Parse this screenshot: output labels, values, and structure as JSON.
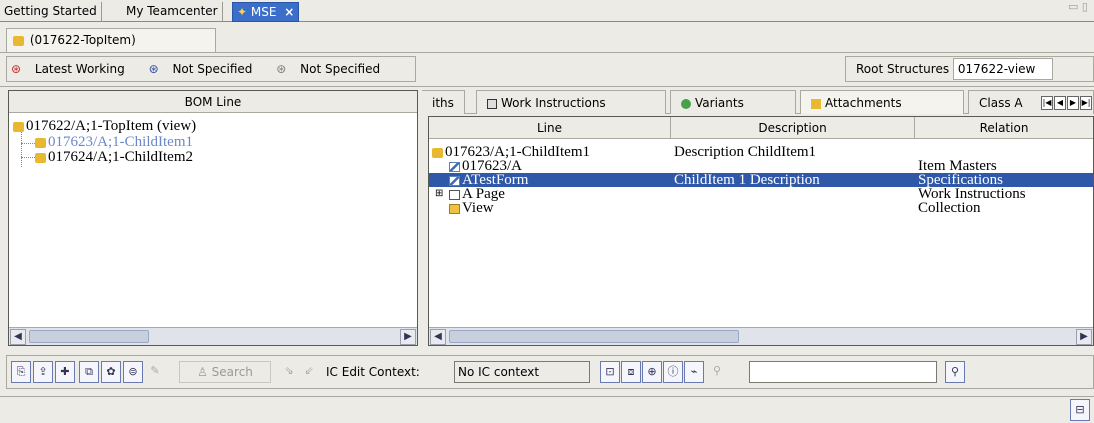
{
  "top_tabs": {
    "getting_started": "Getting Started",
    "my_teamcenter": "My Teamcenter",
    "mse": "MSE",
    "close": "×"
  },
  "sub_tab": {
    "label": "(017622-TopItem)"
  },
  "rule_bar": {
    "latest_working": "Latest Working",
    "not_specified_1": "Not Specified",
    "not_specified_2": "Not Specified",
    "root_structures_label": "Root Structures",
    "root_structures_value": "017622-view"
  },
  "bom_panel": {
    "header": "BOM Line",
    "rows": [
      {
        "label": "017622/A;1-TopItem (view)"
      },
      {
        "label": "017623/A;1-ChildItem1"
      },
      {
        "label": "017624/A;1-ChildItem2"
      }
    ]
  },
  "right_tabs": {
    "paths": "iths",
    "work_instructions": "Work Instructions",
    "variants": "Variants",
    "attachments": "Attachments",
    "class": "Class A"
  },
  "attachments_table": {
    "columns": {
      "line": "Line",
      "description": "Description",
      "relation": "Relation"
    },
    "rows": [
      {
        "line": "017623/A;1-ChildItem1",
        "description": "Description ChildItem1",
        "relation": ""
      },
      {
        "line": "017623/A",
        "description": "",
        "relation": "Item Masters"
      },
      {
        "line": "ATestForm",
        "description": "ChildItem 1 Description",
        "relation": "Specifications"
      },
      {
        "line": "A Page",
        "description": "",
        "relation": "Work Instructions"
      },
      {
        "line": "View",
        "description": "",
        "relation": "Collection"
      }
    ]
  },
  "toolbar": {
    "search_label": "Search",
    "ic_edit_label": "IC Edit Context:",
    "ic_edit_value": "No IC context"
  },
  "colors": {
    "selection": "#3058a8",
    "active_tab": "#3a6ec8",
    "window_bg": "#ecebe6"
  }
}
